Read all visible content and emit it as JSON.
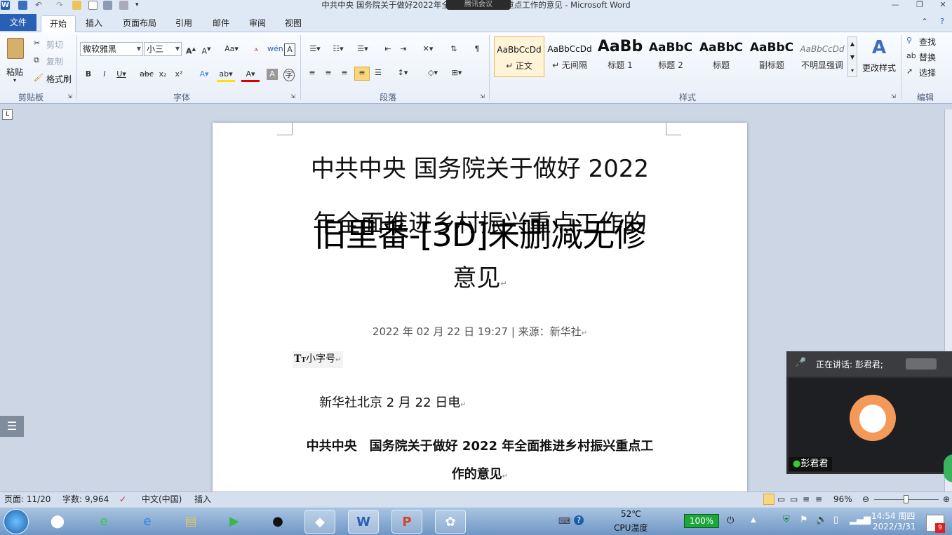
{
  "window": {
    "title": "中共中央 国务院关于做好2022年全面推进乡村振兴重点工作的意见 - Microsoft Word",
    "overlay_badge": "腾讯会议"
  },
  "tabs": {
    "file": "文件",
    "items": [
      "开始",
      "插入",
      "页面布局",
      "引用",
      "邮件",
      "审阅",
      "视图"
    ],
    "active": "开始"
  },
  "clipboard": {
    "paste": "粘贴",
    "cut": "剪切",
    "copy": "复制",
    "format_painter": "格式刷",
    "group": "剪贴板"
  },
  "font": {
    "name": "微软雅黑",
    "size": "小三",
    "group": "字体"
  },
  "paragraph": {
    "group": "段落"
  },
  "styles": {
    "group": "样式",
    "items": [
      {
        "sample": "AaBbCcDd",
        "name": "↵ 正文"
      },
      {
        "sample": "AaBbCcDd",
        "name": "↵ 无间隔"
      },
      {
        "sample": "AaBb",
        "name": "标题 1"
      },
      {
        "sample": "AaBbC",
        "name": "标题 2"
      },
      {
        "sample": "AaBbC",
        "name": "标题"
      },
      {
        "sample": "AaBbC",
        "name": "副标题"
      },
      {
        "sample": "AaBbCcDd",
        "name": "不明显强调"
      }
    ],
    "change": "更改样式"
  },
  "editing": {
    "find": "查找",
    "replace": "替换",
    "select": "选择",
    "group": "编辑"
  },
  "document": {
    "title_line1": "中共中央 国务院关于做好 2022",
    "title_line2": "年全面推进乡村振兴重点工作的",
    "title_line3": "意见",
    "overlay_text": "旧里番-[3D]未删减无修",
    "meta": "2022 年 02 月 22 日 19:27 | 来源：新华社",
    "font_size_label": "小字号",
    "dateline": "新华社北京 2 月 22 日电",
    "subtitle_line1": "中共中央　国务院关于做好 2022 年全面推进乡村振兴重点工",
    "subtitle_line2": "作的意见"
  },
  "meeting": {
    "speaking": "正在讲话: 彭君君;",
    "participant": "彭君君"
  },
  "status": {
    "page": "页面: 11/20",
    "words": "字数: 9,964",
    "lang": "中文(中国)",
    "mode": "插入",
    "zoom": "96%"
  },
  "taskbar": {
    "temp": "52℃",
    "temp_label": "CPU温度",
    "battery": "100%",
    "time": "14:54 周四",
    "date": "2022/3/31",
    "notif": "9"
  }
}
